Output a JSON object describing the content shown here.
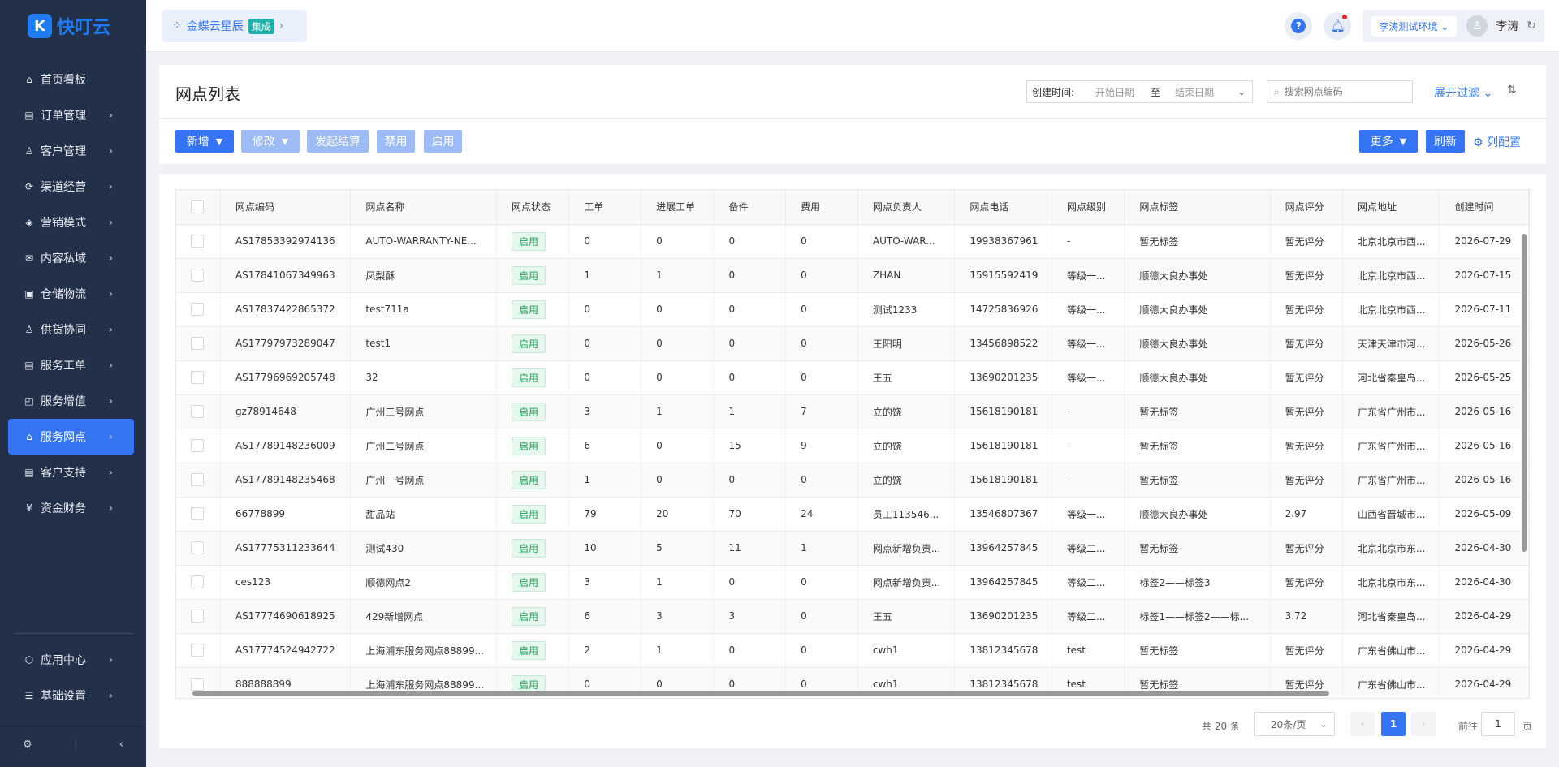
{
  "brand": {
    "mark": "K",
    "name": "快叮云"
  },
  "nav": [
    {
      "icon": "⌂",
      "icon_name": "home-icon",
      "label": "首页看板",
      "chevron": false
    },
    {
      "icon": "▤",
      "icon_name": "order-icon",
      "label": "订单管理",
      "chevron": true
    },
    {
      "icon": "♙",
      "icon_name": "customer-icon",
      "label": "客户管理",
      "chevron": true
    },
    {
      "icon": "⟳",
      "icon_name": "channel-icon",
      "label": "渠道经营",
      "chevron": true
    },
    {
      "icon": "◈",
      "icon_name": "marketing-icon",
      "label": "营销模式",
      "chevron": true
    },
    {
      "icon": "✉",
      "icon_name": "content-icon",
      "label": "内容私域",
      "chevron": true
    },
    {
      "icon": "▣",
      "icon_name": "warehouse-icon",
      "label": "仓储物流",
      "chevron": true
    },
    {
      "icon": "♙",
      "icon_name": "supply-icon",
      "label": "供货协同",
      "chevron": true
    },
    {
      "icon": "▤",
      "icon_name": "ticket-icon",
      "label": "服务工单",
      "chevron": true
    },
    {
      "icon": "◰",
      "icon_name": "value-added-icon",
      "label": "服务增值",
      "chevron": true
    },
    {
      "icon": "⌂",
      "icon_name": "outlet-icon",
      "label": "服务网点",
      "chevron": true,
      "active": true
    },
    {
      "icon": "▤",
      "icon_name": "support-icon",
      "label": "客户支持",
      "chevron": true
    },
    {
      "icon": "¥",
      "icon_name": "finance-icon",
      "label": "资金财务",
      "chevron": true
    }
  ],
  "nav_bottom": [
    {
      "icon": "⬡",
      "icon_name": "app-center-icon",
      "label": "应用中心"
    },
    {
      "icon": "☰",
      "icon_name": "settings-icon",
      "label": "基础设置"
    }
  ],
  "topbar": {
    "tenant_name": "金蝶云星辰",
    "tenant_tag": "集成",
    "env": "李涛测试环境",
    "user": "李涛"
  },
  "header": {
    "title": "网点列表",
    "date_label": "创建时间:",
    "date_start": "开始日期",
    "date_sep": "至",
    "date_end": "结束日期",
    "search_placeholder": "搜索网点编码",
    "expand_filter": "展开过滤",
    "buttons": {
      "add": "新增",
      "edit": "修改",
      "settle": "发起结算",
      "disable": "禁用",
      "enable": "启用",
      "more": "更多",
      "refresh": "刷新",
      "col_config": "列配置"
    }
  },
  "table": {
    "columns": [
      "网点编码",
      "网点名称",
      "网点状态",
      "工单",
      "进展工单",
      "备件",
      "费用",
      "网点负责人",
      "网点电话",
      "网点级别",
      "网点标签",
      "网点评分",
      "网点地址",
      "创建时间"
    ],
    "rows": [
      [
        "AS17853392974136",
        "AUTO-WARRANTY-NE...",
        "启用",
        "0",
        "0",
        "0",
        "0",
        "AUTO-WAR...",
        "19938367961",
        "-",
        "暂无标签",
        "暂无评分",
        "北京北京市西...",
        "2026-07-29"
      ],
      [
        "AS17841067349963",
        "凤梨酥",
        "启用",
        "1",
        "1",
        "0",
        "0",
        "ZHAN",
        "15915592419",
        "等级一...",
        "顺德大良办事处",
        "暂无评分",
        "北京北京市西...",
        "2026-07-15"
      ],
      [
        "AS17837422865372",
        "test711a",
        "启用",
        "0",
        "0",
        "0",
        "0",
        "测试1233",
        "14725836926",
        "等级一...",
        "顺德大良办事处",
        "暂无评分",
        "北京北京市西...",
        "2026-07-11"
      ],
      [
        "AS17797973289047",
        "test1",
        "启用",
        "0",
        "0",
        "0",
        "0",
        "王阳明",
        "13456898522",
        "等级一...",
        "顺德大良办事处",
        "暂无评分",
        "天津天津市河...",
        "2026-05-26"
      ],
      [
        "AS17796969205748",
        "32",
        "启用",
        "0",
        "0",
        "0",
        "0",
        "王五",
        "13690201235",
        "等级一...",
        "顺德大良办事处",
        "暂无评分",
        "河北省秦皇岛...",
        "2026-05-25"
      ],
      [
        "gz78914648",
        "广州三号网点",
        "启用",
        "3",
        "1",
        "1",
        "7",
        "立的饶",
        "15618190181",
        "-",
        "暂无标签",
        "暂无评分",
        "广东省广州市...",
        "2026-05-16"
      ],
      [
        "AS17789148236009",
        "广州二号网点",
        "启用",
        "6",
        "0",
        "15",
        "9",
        "立的饶",
        "15618190181",
        "-",
        "暂无标签",
        "暂无评分",
        "广东省广州市...",
        "2026-05-16"
      ],
      [
        "AS17789148235468",
        "广州一号网点",
        "启用",
        "1",
        "0",
        "0",
        "0",
        "立的饶",
        "15618190181",
        "-",
        "暂无标签",
        "暂无评分",
        "广东省广州市...",
        "2026-05-16"
      ],
      [
        "66778899",
        "甜品站",
        "启用",
        "79",
        "20",
        "70",
        "24",
        "员工113546...",
        "13546807367",
        "等级一...",
        "顺德大良办事处",
        "2.97",
        "山西省晋城市...",
        "2026-05-09"
      ],
      [
        "AS17775311233644",
        "测试430",
        "启用",
        "10",
        "5",
        "11",
        "1",
        "网点新增负责...",
        "13964257845",
        "等级二...",
        "暂无标签",
        "暂无评分",
        "北京北京市东...",
        "2026-04-30"
      ],
      [
        "ces123",
        "顺德网点2",
        "启用",
        "3",
        "1",
        "0",
        "0",
        "网点新增负责...",
        "13964257845",
        "等级二...",
        "标签2——标签3",
        "暂无评分",
        "北京北京市东...",
        "2026-04-30"
      ],
      [
        "AS17774690618925",
        "429新增网点",
        "启用",
        "6",
        "3",
        "3",
        "0",
        "王五",
        "13690201235",
        "等级二...",
        "标签1——标签2——标...",
        "3.72",
        "河北省秦皇岛...",
        "2026-04-29"
      ],
      [
        "AS17774524942722",
        "上海浦东服务网点88899...",
        "启用",
        "2",
        "1",
        "0",
        "0",
        "cwh1",
        "13812345678",
        "test",
        "暂无标签",
        "暂无评分",
        "广东省佛山市...",
        "2026-04-29"
      ],
      [
        "888888899",
        "上海浦东服务网点88899...",
        "启用",
        "0",
        "0",
        "0",
        "0",
        "cwh1",
        "13812345678",
        "test",
        "暂无标签",
        "暂无评分",
        "广东省佛山市...",
        "2026-04-29"
      ]
    ]
  },
  "pager": {
    "total": "共 20 条",
    "page_size": "20条/页",
    "current": "1",
    "goto": "前往",
    "goto_value": "1",
    "page_unit": "页"
  }
}
